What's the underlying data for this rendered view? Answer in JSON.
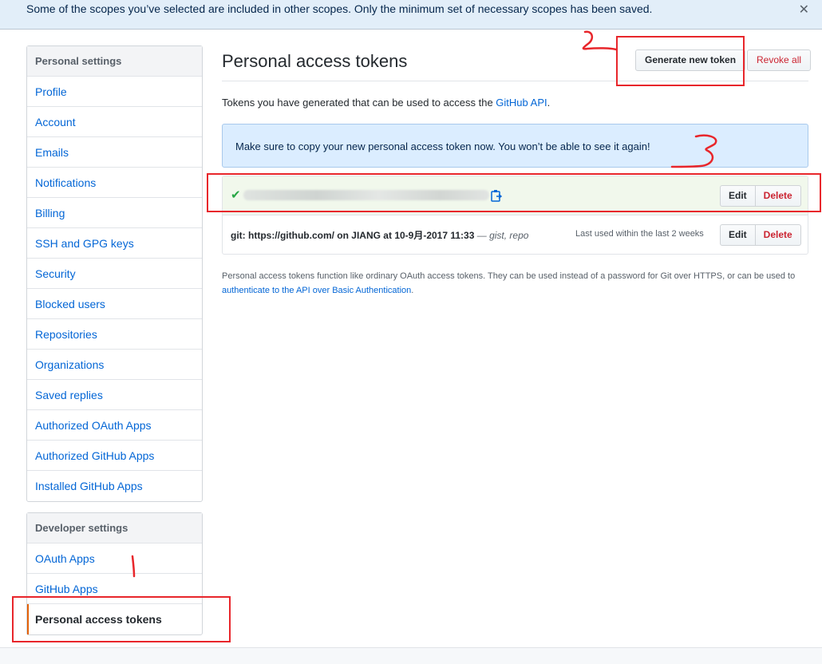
{
  "flash": {
    "message": "Some of the scopes you’ve selected are included in other scopes. Only the minimum set of necessary scopes has been saved.",
    "close_glyph": "✕"
  },
  "sidebar": {
    "personal": {
      "heading": "Personal settings",
      "items": [
        {
          "label": "Profile"
        },
        {
          "label": "Account"
        },
        {
          "label": "Emails"
        },
        {
          "label": "Notifications"
        },
        {
          "label": "Billing"
        },
        {
          "label": "SSH and GPG keys"
        },
        {
          "label": "Security"
        },
        {
          "label": "Blocked users"
        },
        {
          "label": "Repositories"
        },
        {
          "label": "Organizations"
        },
        {
          "label": "Saved replies"
        },
        {
          "label": "Authorized OAuth Apps"
        },
        {
          "label": "Authorized GitHub Apps"
        },
        {
          "label": "Installed GitHub Apps"
        }
      ]
    },
    "developer": {
      "heading": "Developer settings",
      "items": [
        {
          "label": "OAuth Apps"
        },
        {
          "label": "GitHub Apps"
        },
        {
          "label": "Personal access tokens",
          "selected": true
        }
      ]
    }
  },
  "main": {
    "title": "Personal access tokens",
    "generate_label": "Generate new token",
    "revoke_label": "Revoke all",
    "desc_prefix": "Tokens you have generated that can be used to access the ",
    "desc_link": "GitHub API",
    "desc_suffix": ".",
    "notice": "Make sure to copy your new personal access token now. You won’t be able to see it again!",
    "tokens": [
      {
        "edit_label": "Edit",
        "delete_label": "Delete",
        "new": true
      },
      {
        "description": "git: https://github.com/ on JIANG at 10-9月-2017 11:33",
        "separator": " — ",
        "scopes": "gist, repo",
        "last_used": "Last used within the last 2 weeks",
        "edit_label": "Edit",
        "delete_label": "Delete"
      }
    ],
    "footnote_text": "Personal access tokens function like ordinary OAuth access tokens. They can be used instead of a password for Git over HTTPS, or can be used to ",
    "footnote_link": "authenticate to the API over Basic Authentication",
    "footnote_end": "."
  },
  "colors": {
    "link": "#0366d6",
    "danger": "#cb2431",
    "success": "#28a745",
    "annotation": "#e8262b",
    "selected_marker": "#e36209"
  },
  "icons": [
    "close-icon",
    "check-icon",
    "clipboard-icon"
  ]
}
